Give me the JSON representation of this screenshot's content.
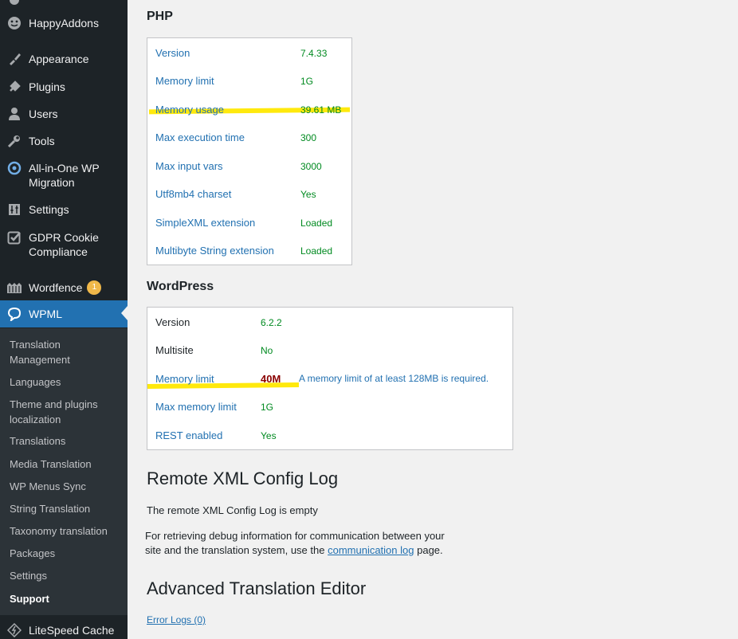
{
  "sidebar": {
    "items": [
      {
        "label": "HappyAddons",
        "icon": "happyaddons-icon"
      },
      {
        "label": "Appearance",
        "icon": "brush-icon"
      },
      {
        "label": "Plugins",
        "icon": "plugin-icon"
      },
      {
        "label": "Users",
        "icon": "user-icon"
      },
      {
        "label": "Tools",
        "icon": "wrench-icon"
      },
      {
        "label": "All-in-One WP",
        "label2": "Migration",
        "icon": "migration-icon"
      },
      {
        "label": "Settings",
        "icon": "settings-icon"
      },
      {
        "label": "GDPR Cookie",
        "label2": "Compliance",
        "icon": "checkbox-icon"
      },
      {
        "label": "Wordfence",
        "badge": "1",
        "icon": "wordfence-icon"
      },
      {
        "label": "WPML",
        "icon": "wpml-icon"
      },
      {
        "label": "LiteSpeed Cache",
        "icon": "litespeed-icon"
      }
    ],
    "submenu": [
      {
        "label": "Translation",
        "label2": "Management"
      },
      {
        "label": "Languages"
      },
      {
        "label": "Theme and plugins",
        "label2": "localization"
      },
      {
        "label": "Translations"
      },
      {
        "label": "Media Translation"
      },
      {
        "label": "WP Menus Sync"
      },
      {
        "label": "String Translation"
      },
      {
        "label": "Taxonomy translation"
      },
      {
        "label": "Packages"
      },
      {
        "label": "Settings"
      },
      {
        "label": "Support"
      }
    ]
  },
  "php": {
    "title": "PHP",
    "rows": [
      {
        "label": "Version",
        "value": "7.4.33"
      },
      {
        "label": "Memory limit",
        "value": "1G"
      },
      {
        "label": "Memory usage",
        "value": "39.61 MB"
      },
      {
        "label": "Max execution time",
        "value": "300"
      },
      {
        "label": "Max input vars",
        "value": "3000"
      },
      {
        "label": "Utf8mb4 charset",
        "value": "Yes"
      },
      {
        "label": "SimpleXML extension",
        "value": "Loaded"
      },
      {
        "label": "Multibyte String extension",
        "value": "Loaded"
      }
    ]
  },
  "wordpress": {
    "title": "WordPress",
    "rows": [
      {
        "label": "Version",
        "value": "6.2.2"
      },
      {
        "label": "Multisite",
        "value": "No"
      },
      {
        "label": "Memory limit",
        "value": "40M",
        "note": "A memory limit of at least 128MB is required."
      },
      {
        "label": "Max memory limit",
        "value": "1G"
      },
      {
        "label": "REST enabled",
        "value": "Yes"
      }
    ]
  },
  "remote_log": {
    "title": "Remote XML Config Log",
    "empty_text": "The remote XML Config Log is empty",
    "info_line1": "For retrieving debug information for communication between your",
    "info_line2_pre": "site and the translation system, use the",
    "info_link": "communication log",
    "info_line2_post": "page."
  },
  "ate": {
    "title": "Advanced Translation Editor",
    "error_logs": "Error Logs (0)"
  },
  "colors": {
    "sidebar_bg": "#1d2327",
    "active": "#2271b1",
    "value_green": "#008a20",
    "error_red": "#8a0000",
    "highlight": "#ffe800"
  }
}
